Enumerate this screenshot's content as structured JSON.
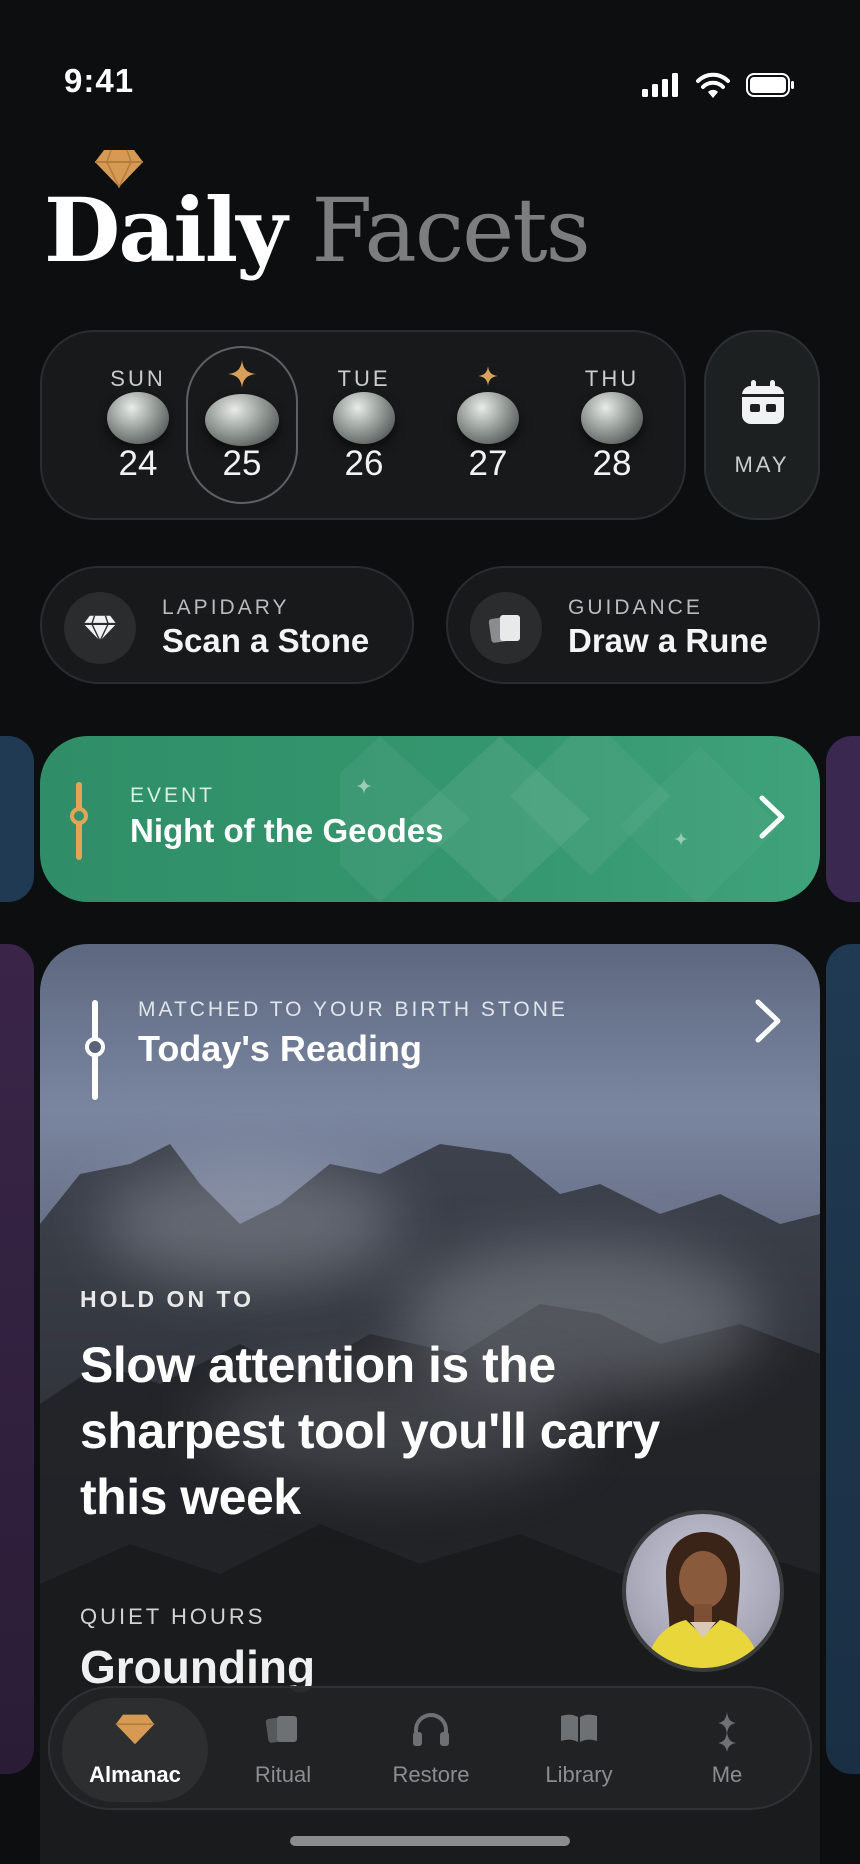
{
  "status_bar": {
    "time": "9:41",
    "icons": [
      "cellular-signal-icon",
      "wifi-icon",
      "battery-icon"
    ]
  },
  "header": {
    "logo_icon": "diamond-icon",
    "title_primary": "Daily",
    "title_secondary": "Facets"
  },
  "week": {
    "days": [
      {
        "name": "SUN",
        "number": "24",
        "selected": false,
        "spark": false
      },
      {
        "name": "",
        "number": "25",
        "selected": true,
        "spark": true
      },
      {
        "name": "TUE",
        "number": "26",
        "selected": false,
        "spark": false
      },
      {
        "name": "",
        "number": "27",
        "selected": false,
        "spark": true
      },
      {
        "name": "THU",
        "number": "28",
        "selected": false,
        "spark": false
      }
    ],
    "month_button": {
      "icon": "calendar-icon",
      "label": "MAY"
    }
  },
  "actions": [
    {
      "kicker": "LAPIDARY",
      "title": "Scan a Stone",
      "icon": "diamond-icon"
    },
    {
      "kicker": "GUIDANCE",
      "title": "Draw a Rune",
      "icon": "rune-cards-icon"
    }
  ],
  "event": {
    "kicker": "EVENT",
    "title": "Night of the Geodes",
    "accent": "#e3a455",
    "background": "#35976f"
  },
  "reading": {
    "kicker": "MATCHED TO YOUR BIRTH STONE",
    "title": "Today's Reading",
    "hold_kicker": "HOLD ON TO",
    "quote": "Slow attention is the sharpest tool you'll carry this week",
    "quiet_kicker": "QUIET HOURS",
    "quiet_title": "Grounding"
  },
  "tabs": [
    {
      "label": "Almanac",
      "icon": "diamond-icon",
      "active": true
    },
    {
      "label": "Ritual",
      "icon": "cards-icon",
      "active": false
    },
    {
      "label": "Restore",
      "icon": "headphones-icon",
      "active": false
    },
    {
      "label": "Library",
      "icon": "book-icon",
      "active": false
    },
    {
      "label": "Me",
      "icon": "sparkle-icon",
      "active": false
    }
  ],
  "colors": {
    "background": "#0d0e0f",
    "gold": "#d9a05a",
    "event_green": "#35976f"
  }
}
